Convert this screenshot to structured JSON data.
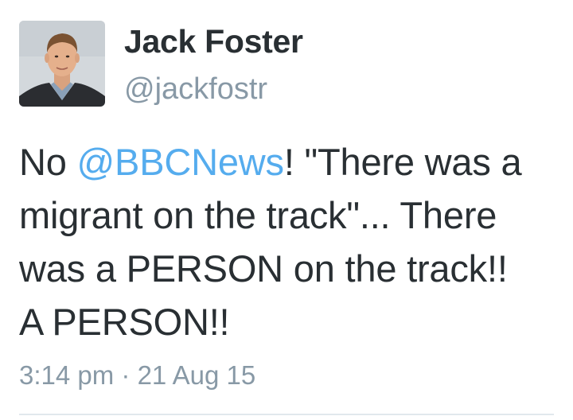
{
  "user": {
    "display_name": "Jack Foster",
    "handle": "@jackfostr"
  },
  "tweet": {
    "line1_pre": "No ",
    "mention": "@BBCNews",
    "line1_post": "! \"There was a",
    "line2": "migrant on the track\"... There",
    "line3": "was a PERSON on the track!!",
    "line4": "A PERSON!!",
    "timestamp": "3:14 pm · 21 Aug 15"
  },
  "colors": {
    "text": "#292f33",
    "secondary": "#8899a6",
    "mention": "#55acee",
    "divider": "#e1e8ed"
  }
}
